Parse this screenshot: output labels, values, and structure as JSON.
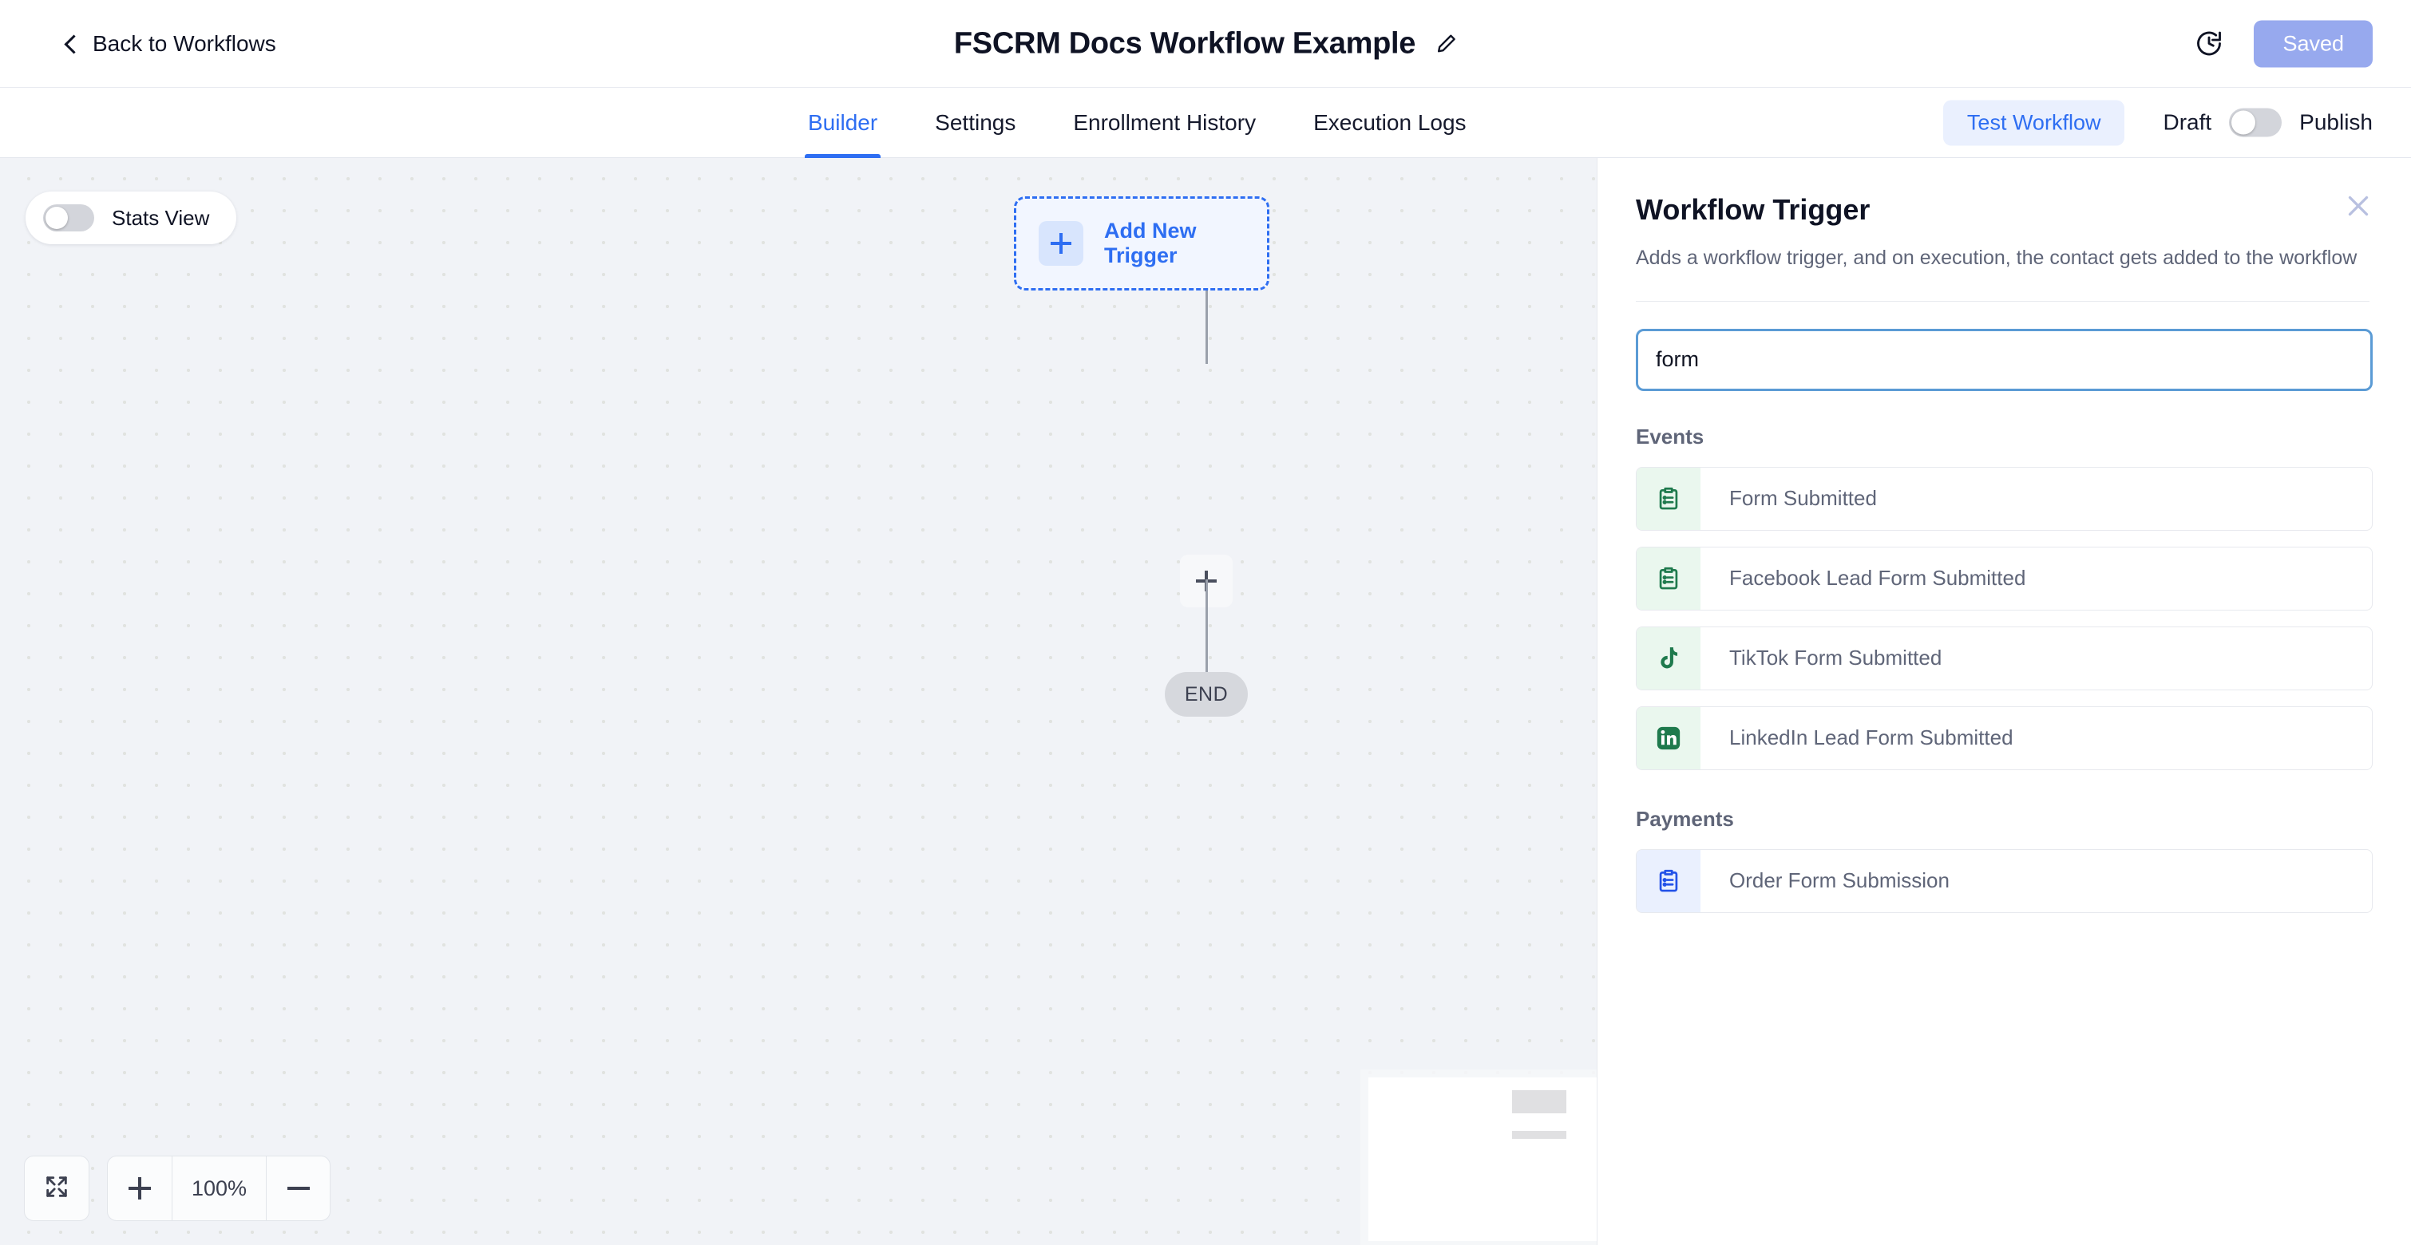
{
  "topbar": {
    "back_label": "Back to Workflows",
    "back_icon": "chevron-left-icon",
    "workflow_title": "FSCRM Docs Workflow Example",
    "edit_icon": "pencil-icon",
    "history_icon": "clock-history-icon",
    "save_status": "Saved",
    "save_status_color": "#97a9ee"
  },
  "tabs": [
    {
      "label": "Builder",
      "active": true
    },
    {
      "label": "Settings",
      "active": false
    },
    {
      "label": "Enrollment History",
      "active": false
    },
    {
      "label": "Execution Logs",
      "active": false
    }
  ],
  "tabbar_right": {
    "test_workflow_label": "Test Workflow",
    "draft_label": "Draft",
    "publish_label": "Publish",
    "publish_toggle_on": false,
    "accent_color": "#2e6ef2"
  },
  "canvas": {
    "stats_view_label": "Stats View",
    "stats_view_on": false,
    "trigger_node_label": "Add New Trigger",
    "trigger_plus_icon": "plus-icon",
    "mid_plus_icon": "plus-icon",
    "end_node_label": "END",
    "zoom": {
      "fit_icon": "fit-to-screen-icon",
      "zoom_in_icon": "plus-icon",
      "zoom_level": "100%",
      "zoom_out_icon": "minus-icon"
    }
  },
  "panel": {
    "title": "Workflow Trigger",
    "description": "Adds a workflow trigger, and on execution, the contact gets added to the workflow",
    "close_icon": "close-icon",
    "search": {
      "value": "form",
      "placeholder": ""
    },
    "groups": [
      {
        "title": "Events",
        "items": [
          {
            "label": "Form Submitted",
            "icon": "clipboard-list-icon",
            "icon_tone": "green"
          },
          {
            "label": "Facebook Lead Form Submitted",
            "icon": "clipboard-list-icon",
            "icon_tone": "green"
          },
          {
            "label": "TikTok Form Submitted",
            "icon": "tiktok-icon",
            "icon_tone": "green"
          },
          {
            "label": "LinkedIn Lead Form Submitted",
            "icon": "linkedin-icon",
            "icon_tone": "green"
          }
        ]
      },
      {
        "title": "Payments",
        "items": [
          {
            "label": "Order Form Submission",
            "icon": "clipboard-list-icon",
            "icon_tone": "blue"
          }
        ]
      }
    ]
  }
}
